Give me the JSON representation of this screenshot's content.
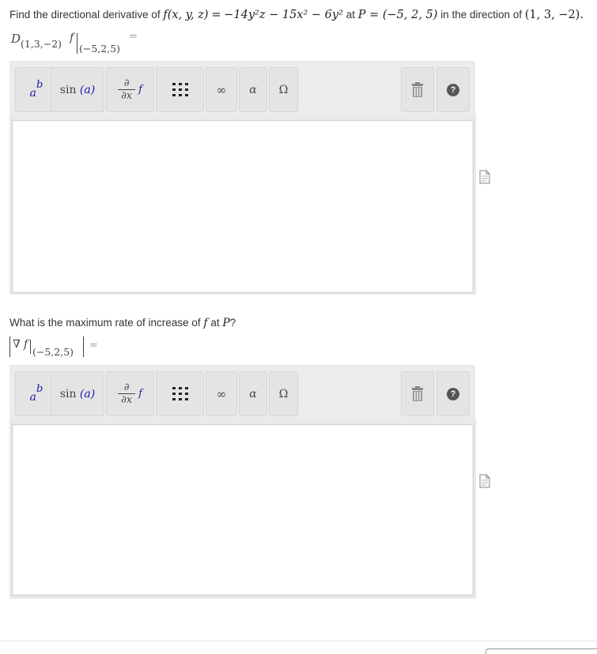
{
  "question1": {
    "text_find": "Find the directional derivative of",
    "func_lhs": "f(x, y, z)",
    "eq": "=",
    "func_rhs": "−14y²z − 15x² − 6y²",
    "text_at": "at",
    "point": "P = (−5, 2, 5)",
    "text_dir": "in the direction of",
    "direction": "(1, 3, −2).",
    "prompt_D": "D",
    "prompt_sub": "(1,3,−2)",
    "prompt_f": "f",
    "prompt_eval": "(−5,2,5)",
    "prompt_eq": "="
  },
  "question2": {
    "text_before": "What is the maximum rate of increase of",
    "f": "f",
    "text_at": "at",
    "P": "P",
    "text_q": "?",
    "prompt_nabla": "∇",
    "prompt_f": "f",
    "prompt_eval": "(−5,2,5)",
    "prompt_eq": "="
  },
  "toolbar": {
    "power_base": "a",
    "power_exp": "b",
    "sin_label": "sin",
    "sin_arg": "(a)",
    "partial_top": "∂",
    "partial_bottom": "∂x",
    "partial_f": "f",
    "matrix_icon": "matrix-icon",
    "infinity": "∞",
    "alpha": "α",
    "omega": "Ω",
    "trash_icon": "trash-icon",
    "help_label": "?"
  },
  "editor1": {
    "value": ""
  },
  "editor2": {
    "value": ""
  },
  "colors": {
    "toolbar_bg": "#ececec",
    "button_bg": "#e4e4e4",
    "math_blue": "#1a1aa6",
    "help_bg": "#555555"
  }
}
